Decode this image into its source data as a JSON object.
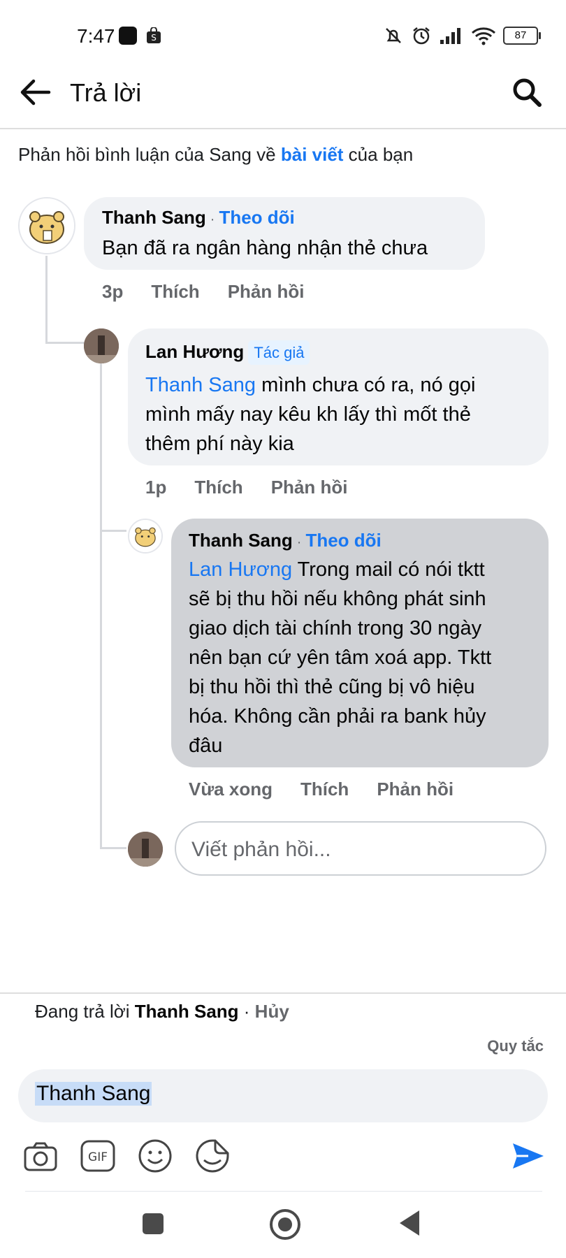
{
  "status": {
    "time": "7:47",
    "battery": "87"
  },
  "header": {
    "title": "Trả lời"
  },
  "context": {
    "prefix": "Phản hồi bình luận của Sang về ",
    "link": "bài viết",
    "suffix": " của bạn"
  },
  "comments": [
    {
      "author": "Thanh Sang",
      "dot": "·",
      "follow": "Theo dõi",
      "text": "Bạn đã ra ngân hàng nhận thẻ chưa",
      "time": "3p",
      "like": "Thích",
      "reply": "Phản hồi"
    },
    {
      "author": "Lan Hương",
      "badge": "Tác giả",
      "mention": "Thanh Sang",
      "text_line1": " mình chưa có ra, nó gọi",
      "text_line2": "mình mấy nay kêu kh lấy thì mốt thẻ",
      "text_line3": "thêm phí này kia",
      "time": "1p",
      "like": "Thích",
      "reply": "Phản hồi"
    },
    {
      "author": "Thanh Sang",
      "dot": "·",
      "follow": "Theo dõi",
      "mention": "Lan Hương",
      "text_line1": " Trong mail có nói tktt",
      "text_line2": "sẽ bị thu hồi nếu không phát sinh",
      "text_line3": "giao dịch tài chính trong 30 ngày",
      "text_line4": "nên bạn cứ yên tâm xoá app. Tktt",
      "text_line5": "bị thu hồi thì thẻ cũng bị vô hiệu",
      "text_line6": "hóa. Không cần phải ra bank hủy",
      "text_line7": "đâu",
      "time": "Vừa xong",
      "like": "Thích",
      "reply": "Phản hồi"
    }
  ],
  "reply_input": {
    "placeholder": "Viết phản hồi..."
  },
  "composer": {
    "replying_prefix": "Đang trả lời ",
    "replying_name": "Thanh Sang",
    "replying_sep": " · ",
    "cancel": "Hủy",
    "rules": "Quy tắc",
    "text": "Thanh Sang",
    "gif_label": "GIF"
  },
  "colors": {
    "accent": "#1877f2",
    "muted": "#65676b",
    "bubble": "#f0f2f5",
    "bubble_selected": "#d0d2d6"
  },
  "icons": [
    "back-arrow-icon",
    "search-icon",
    "camera-icon",
    "gif-icon",
    "emoji-icon",
    "sticker-icon",
    "send-icon"
  ]
}
